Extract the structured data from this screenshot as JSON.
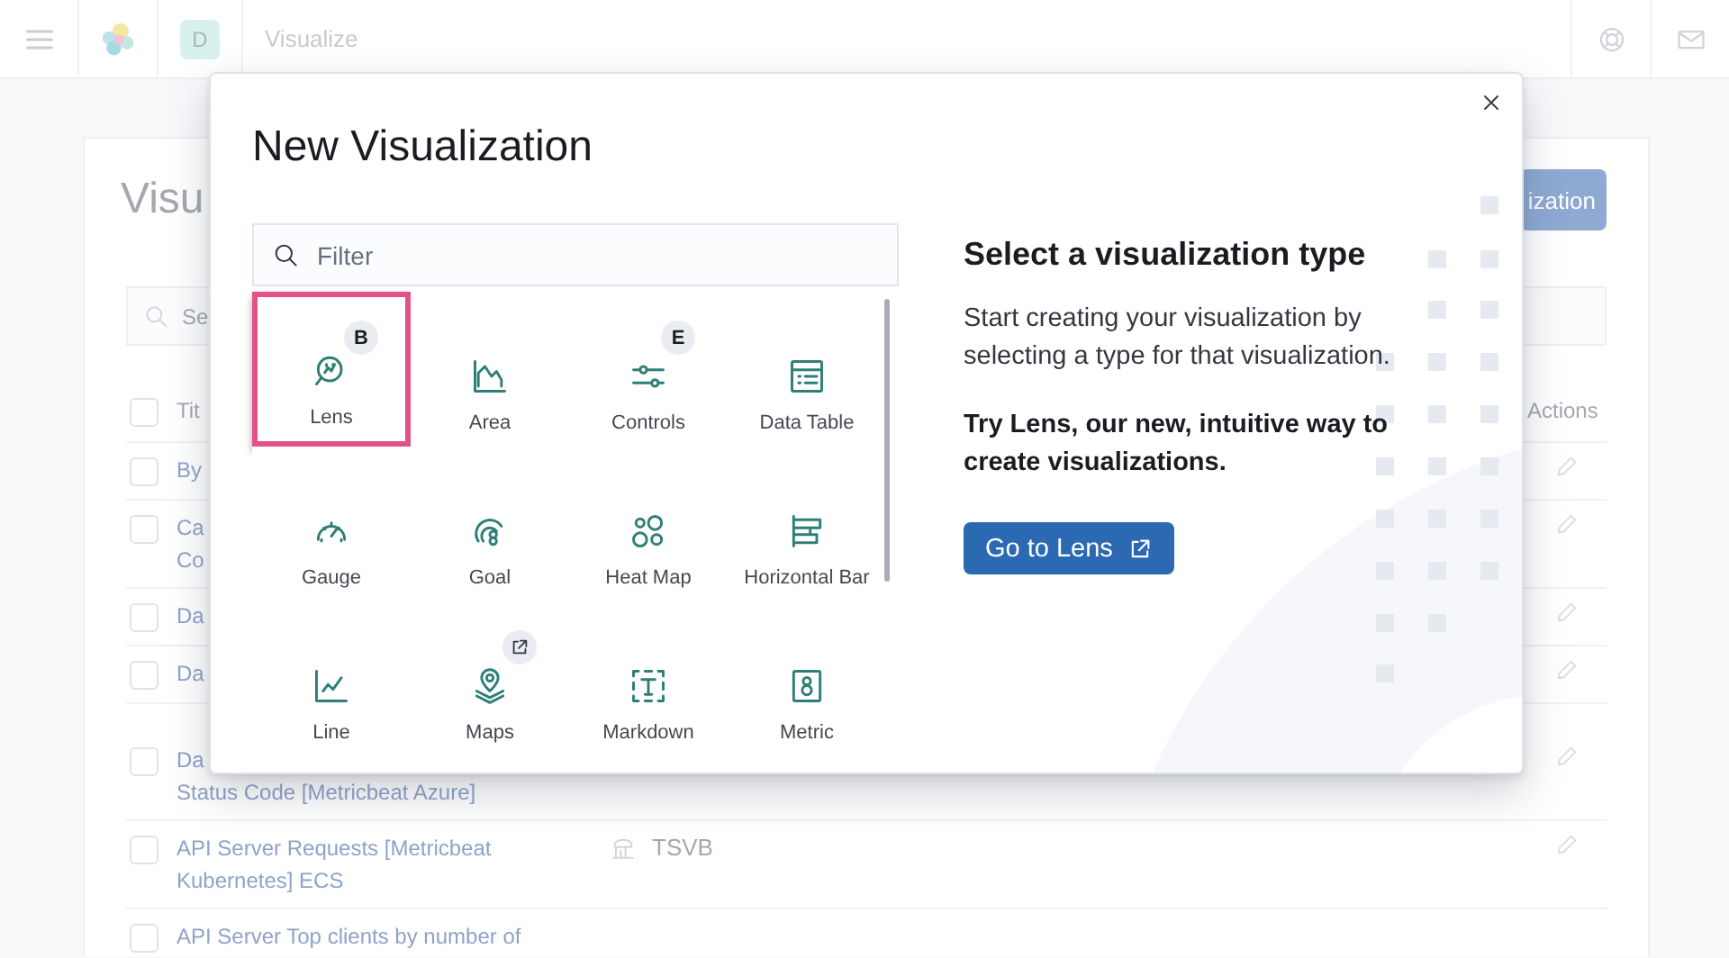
{
  "header": {
    "space_initial": "D",
    "breadcrumb": "Visualize"
  },
  "page": {
    "title": "Visu",
    "create_button": "ization",
    "search_placeholder": "Se",
    "select_all": {
      "checked": false
    },
    "columns": [
      {
        "label": "Tit"
      },
      {
        "label": "Actions"
      }
    ],
    "rows": [
      {
        "checked": false,
        "title_lines": [
          "By"
        ]
      },
      {
        "checked": false,
        "title_lines": [
          "Ca",
          "Co"
        ]
      },
      {
        "checked": false,
        "title_lines": [
          "Da"
        ]
      },
      {
        "checked": false,
        "title_lines": [
          "Da"
        ]
      },
      {
        "checked": false,
        "title_lines": [
          "Da",
          "Status Code [Metricbeat Azure]"
        ]
      },
      {
        "checked": false,
        "title_lines": [
          "API Server Requests [Metricbeat",
          "Kubernetes] ECS"
        ],
        "type": "TSVB"
      },
      {
        "checked": false,
        "title_lines": [
          "API Server Top clients by number of"
        ]
      }
    ]
  },
  "modal": {
    "title": "New Visualization",
    "filter_placeholder": "Filter",
    "types": [
      {
        "label": "Lens",
        "selected": true,
        "badge": {
          "kind": "letter",
          "text": "B"
        }
      },
      {
        "label": "Area",
        "selected": false
      },
      {
        "label": "Controls",
        "selected": false,
        "badge": {
          "kind": "letter",
          "text": "E"
        }
      },
      {
        "label": "Data Table",
        "selected": false
      },
      {
        "label": "Gauge",
        "selected": false
      },
      {
        "label": "Goal",
        "selected": false
      },
      {
        "label": "Heat Map",
        "selected": false
      },
      {
        "label": "Horizontal Bar",
        "selected": false
      },
      {
        "label": "Line",
        "selected": false
      },
      {
        "label": "Maps",
        "selected": false,
        "badge": {
          "kind": "external_link"
        }
      },
      {
        "label": "Markdown",
        "selected": false
      },
      {
        "label": "Metric",
        "selected": false
      }
    ],
    "info_title": "Select a visualization type",
    "info_text": "Start creating your visualization by selecting a type for that visualization.",
    "info_promo": "Try Lens, our new, intuitive way to create visualizations.",
    "lens_button": "Go to Lens"
  }
}
